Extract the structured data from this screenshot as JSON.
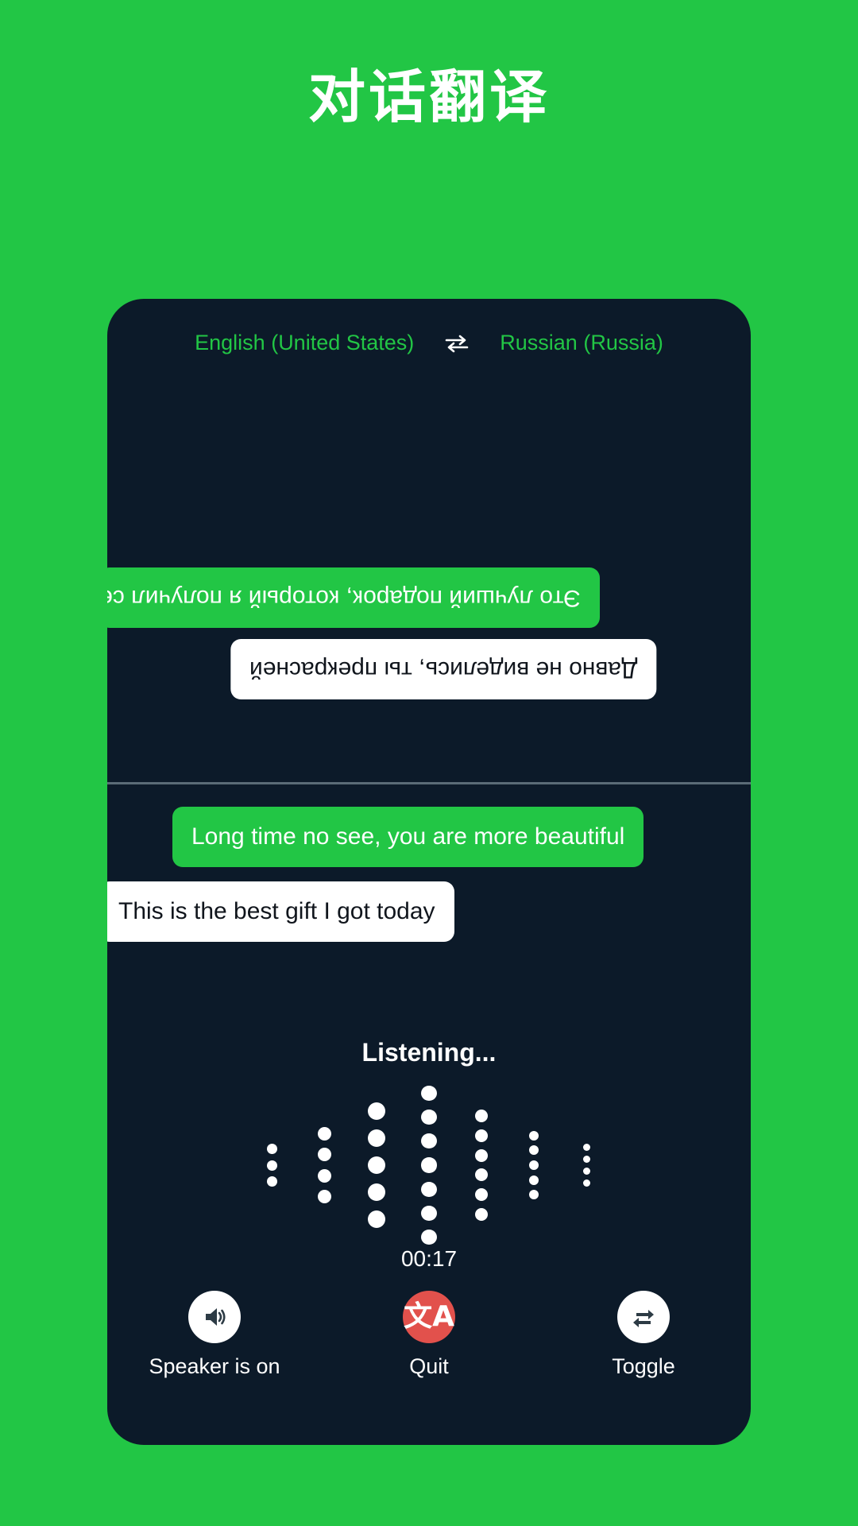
{
  "page": {
    "title": "对话翻译",
    "background_color": "#22c645"
  },
  "panel": {
    "background_color": "#0c1a29",
    "accent_color": "#22c645",
    "danger_color": "#e2514c"
  },
  "language_bar": {
    "source_language": "English (United States)",
    "target_language": "Russian (Russia)",
    "swap_icon": "swap-horizontal-icon"
  },
  "conversation": {
    "remote_pane": {
      "orientation": "rotated-180",
      "messages": [
        {
          "text": "Это лучший подарок, который я получил сегодня",
          "style": "green"
        },
        {
          "text": "Давно не виделись, ты прекрасней",
          "style": "white"
        }
      ]
    },
    "local_pane": {
      "orientation": "normal",
      "messages": [
        {
          "text": "Long time no see, you are more beautiful",
          "style": "green"
        },
        {
          "text": "This is the best gift I got today",
          "style": "white"
        }
      ]
    }
  },
  "status": {
    "listening_label": "Listening...",
    "timer": "00:17"
  },
  "waveform": {
    "columns": [
      {
        "dots": 3,
        "size": 13
      },
      {
        "dots": 4,
        "size": 17
      },
      {
        "dots": 5,
        "size": 22
      },
      {
        "dots": 7,
        "size": 20
      },
      {
        "dots": 6,
        "size": 16
      },
      {
        "dots": 5,
        "size": 12
      },
      {
        "dots": 4,
        "size": 9
      }
    ]
  },
  "controls": [
    {
      "label": "Speaker is on",
      "icon": "speaker-on-icon",
      "style": "light"
    },
    {
      "label": "Quit",
      "icon": "translate-icon",
      "style": "danger",
      "glyph": "文A"
    },
    {
      "label": "Toggle",
      "icon": "repeat-swap-icon",
      "style": "light"
    }
  ]
}
